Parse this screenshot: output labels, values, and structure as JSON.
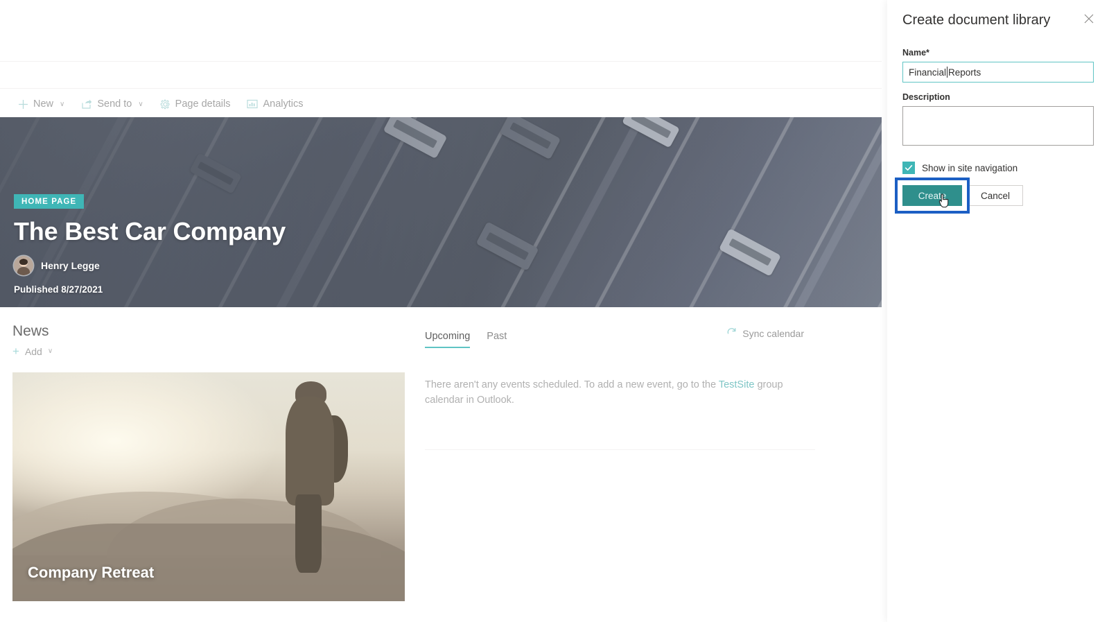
{
  "commandbar": {
    "items": [
      {
        "label": "New",
        "icon": "plus-icon",
        "chevron": "∨"
      },
      {
        "label": "Send to",
        "icon": "share-icon",
        "chevron": "∨"
      },
      {
        "label": "Page details",
        "icon": "gear-icon",
        "chevron": ""
      },
      {
        "label": "Analytics",
        "icon": "analytics-icon",
        "chevron": ""
      }
    ]
  },
  "hero": {
    "badge": "HOME PAGE",
    "title": "The Best Car Company",
    "author": "Henry Legge",
    "published": "Published 8/27/2021",
    "image_alt": "aerial-highway-photo"
  },
  "news": {
    "heading": "News",
    "add_label": "Add",
    "add_icon": "plus-icon",
    "add_chevron": "∨",
    "card": {
      "title": "Company Retreat",
      "image_alt": "hiker-sunrise-photo"
    }
  },
  "events": {
    "tabs": [
      {
        "label": "Upcoming",
        "active": true
      },
      {
        "label": "Past",
        "active": false
      }
    ],
    "sync_label": "Sync calendar",
    "sync_icon": "refresh-icon",
    "empty_text_before": "There aren't any events scheduled. To add a new event, go to the ",
    "empty_link": "TestSite",
    "empty_text_after": " group calendar in Outlook."
  },
  "panel": {
    "title": "Create document library",
    "close_icon": "close-icon",
    "name_label": "Name",
    "name_required_mark": "*",
    "name_value_before_caret": "Financial",
    "name_value_after_caret": "Reports",
    "name_value": "Financial Reports",
    "description_label": "Description",
    "description_value": "",
    "description_placeholder": "",
    "show_in_nav_label": "Show in site navigation",
    "show_in_nav_checked": true,
    "create_label": "Create",
    "cancel_label": "Cancel"
  },
  "colors": {
    "accent_teal": "#3fb6b6",
    "create_button": "#2f8f8c",
    "highlight_blue": "#1c5fc4",
    "link_teal": "#7fc6c6"
  }
}
